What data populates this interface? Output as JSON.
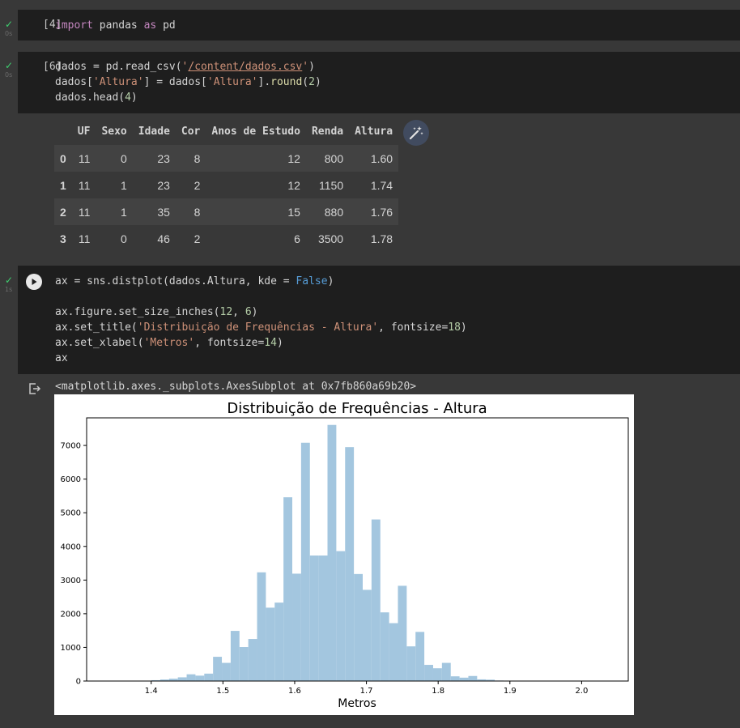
{
  "cells": [
    {
      "exec_count": "[4]",
      "time": "0s"
    },
    {
      "exec_count": "[6]",
      "time": "0s"
    },
    {
      "time": "1s"
    }
  ],
  "code": {
    "cell1": {
      "import": "import",
      "mod": " pandas ",
      "as": "as",
      "alias": " pd"
    },
    "cell2": {
      "l1a": "dados = pd.read_csv(",
      "l1q": "'",
      "l1s": "/content/dados.csv",
      "l1q2": "'",
      "l1b": ")",
      "l2a": "dados[",
      "l2s": "'Altura'",
      "l2b": "] = dados[",
      "l2s2": "'Altura'",
      "l2c": "].",
      "l2f": "round",
      "l2d": "(",
      "l2n": "2",
      "l2e": ")",
      "l3a": "dados.head(",
      "l3n": "4",
      "l3b": ")"
    },
    "cell3": {
      "l1a": "ax = sns.distplot(dados.Altura, kde = ",
      "l1b": "False",
      "l1c": ")",
      "l2a": "ax.figure.set_size_inches(",
      "l2n1": "12",
      "l2b": ", ",
      "l2n2": "6",
      "l2c": ")",
      "l3a": "ax.set_title(",
      "l3s": "'Distribuição de Frequências - Altura'",
      "l3b": ", fontsize=",
      "l3n": "18",
      "l3c": ")",
      "l4a": "ax.set_xlabel(",
      "l4s": "'Metros'",
      "l4b": ", fontsize=",
      "l4n": "14",
      "l4c": ")",
      "l5": "ax"
    }
  },
  "dataframe": {
    "columns": [
      "",
      "UF",
      "Sexo",
      "Idade",
      "Cor",
      "Anos de Estudo",
      "Renda",
      "Altura"
    ],
    "rows": [
      [
        "0",
        "11",
        "0",
        "23",
        "8",
        "12",
        "800",
        "1.60"
      ],
      [
        "1",
        "11",
        "1",
        "23",
        "2",
        "12",
        "1150",
        "1.74"
      ],
      [
        "2",
        "11",
        "1",
        "35",
        "8",
        "15",
        "880",
        "1.76"
      ],
      [
        "3",
        "11",
        "0",
        "46",
        "2",
        "6",
        "3500",
        "1.78"
      ]
    ]
  },
  "output_text": "<matplotlib.axes._subplots.AxesSubplot at 0x7fb860a69b20>",
  "icons": {
    "check": "check-icon",
    "magic": "magic-wand-icon",
    "run": "play-icon",
    "output": "output-icon"
  },
  "colors": {
    "bar": "#a3c6df",
    "check": "#3ecf6f"
  },
  "chart_data": {
    "type": "bar",
    "title": "Distribuição de Frequências - Altura",
    "xlabel": "Metros",
    "ylabel": "",
    "xlim": [
      1.31,
      2.065
    ],
    "ylim": [
      0,
      7820
    ],
    "xticks": [
      "1.4",
      "1.5",
      "1.6",
      "1.7",
      "1.8",
      "1.9",
      "2.0"
    ],
    "yticks": [
      "0",
      "1000",
      "2000",
      "3000",
      "4000",
      "5000",
      "6000",
      "7000"
    ],
    "bins": {
      "start": 1.339,
      "width": 0.01227,
      "values": [
        2,
        3,
        5,
        8,
        10,
        25,
        45,
        70,
        110,
        200,
        160,
        220,
        720,
        540,
        1490,
        1010,
        1250,
        3230,
        2180,
        2330,
        5460,
        3190,
        7080,
        3730,
        3730,
        7610,
        3860,
        6950,
        3180,
        2710,
        4800,
        2040,
        1720,
        2830,
        1030,
        1460,
        480,
        380,
        540,
        140,
        100,
        150,
        50,
        40,
        15,
        10,
        5,
        3,
        2,
        1
      ]
    }
  }
}
